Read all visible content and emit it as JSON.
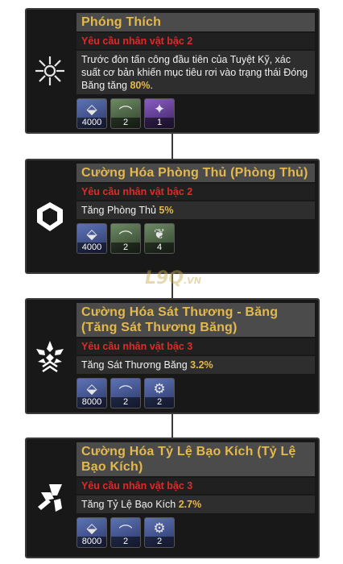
{
  "colors": {
    "title_gold": "#e4b94c",
    "requirement_red": "#e02a2a",
    "card_bg": "#181818"
  },
  "watermark": {
    "text": "L9Q",
    "suffix": ".VN"
  },
  "skills": [
    {
      "title": "Phóng Thích",
      "requirement": "Yêu cầu nhân vật bậc 2",
      "desc_pre": "Trước đòn tấn công đầu tiên của Tuyệt Kỹ, xác suất cơ bản khiến mục tiêu rơi vào trạng thái Đóng Băng tăng ",
      "desc_value": "80%",
      "desc_post": ".",
      "icon": "snowflake-burst-icon",
      "items": [
        {
          "icon": "crystal-blade-icon",
          "count": "4000"
        },
        {
          "icon": "claw-material-icon",
          "count": "2"
        },
        {
          "icon": "purple-orb-icon",
          "count": "1"
        }
      ]
    },
    {
      "title": "Cường Hóa Phòng Thủ (Phòng Thủ)",
      "requirement": "Yêu cầu nhân vật bậc 2",
      "desc_pre": "Tăng Phòng Thủ ",
      "desc_value": "5%",
      "desc_post": "",
      "icon": "shield-icon",
      "items": [
        {
          "icon": "crystal-blade-icon",
          "count": "4000"
        },
        {
          "icon": "claw-material-icon",
          "count": "2"
        },
        {
          "icon": "leaf-material-icon",
          "count": "4"
        }
      ]
    },
    {
      "title": "Cường Hóa Sát Thương - Băng (Tăng Sát Thương Băng)",
      "requirement": "Yêu cầu nhân vật bậc 3",
      "desc_pre": "Tăng Sát Thương Băng ",
      "desc_value": "3.2%",
      "desc_post": "",
      "icon": "ice-damage-icon",
      "items": [
        {
          "icon": "crystal-blade-icon",
          "count": "8000"
        },
        {
          "icon": "claw-material-icon",
          "count": "2"
        },
        {
          "icon": "gear-material-icon",
          "count": "2"
        }
      ]
    },
    {
      "title": "Cường Hóa Tỷ Lệ Bạo Kích (Tỷ Lệ Bạo Kích)",
      "requirement": "Yêu cầu nhân vật bậc 3",
      "desc_pre": "Tăng Tỷ Lệ Bạo Kích ",
      "desc_value": "2.7%",
      "desc_post": "",
      "icon": "crit-strike-icon",
      "items": [
        {
          "icon": "crystal-blade-icon",
          "count": "8000"
        },
        {
          "icon": "claw-material-icon",
          "count": "2"
        },
        {
          "icon": "gear-material-icon",
          "count": "2"
        }
      ]
    }
  ]
}
